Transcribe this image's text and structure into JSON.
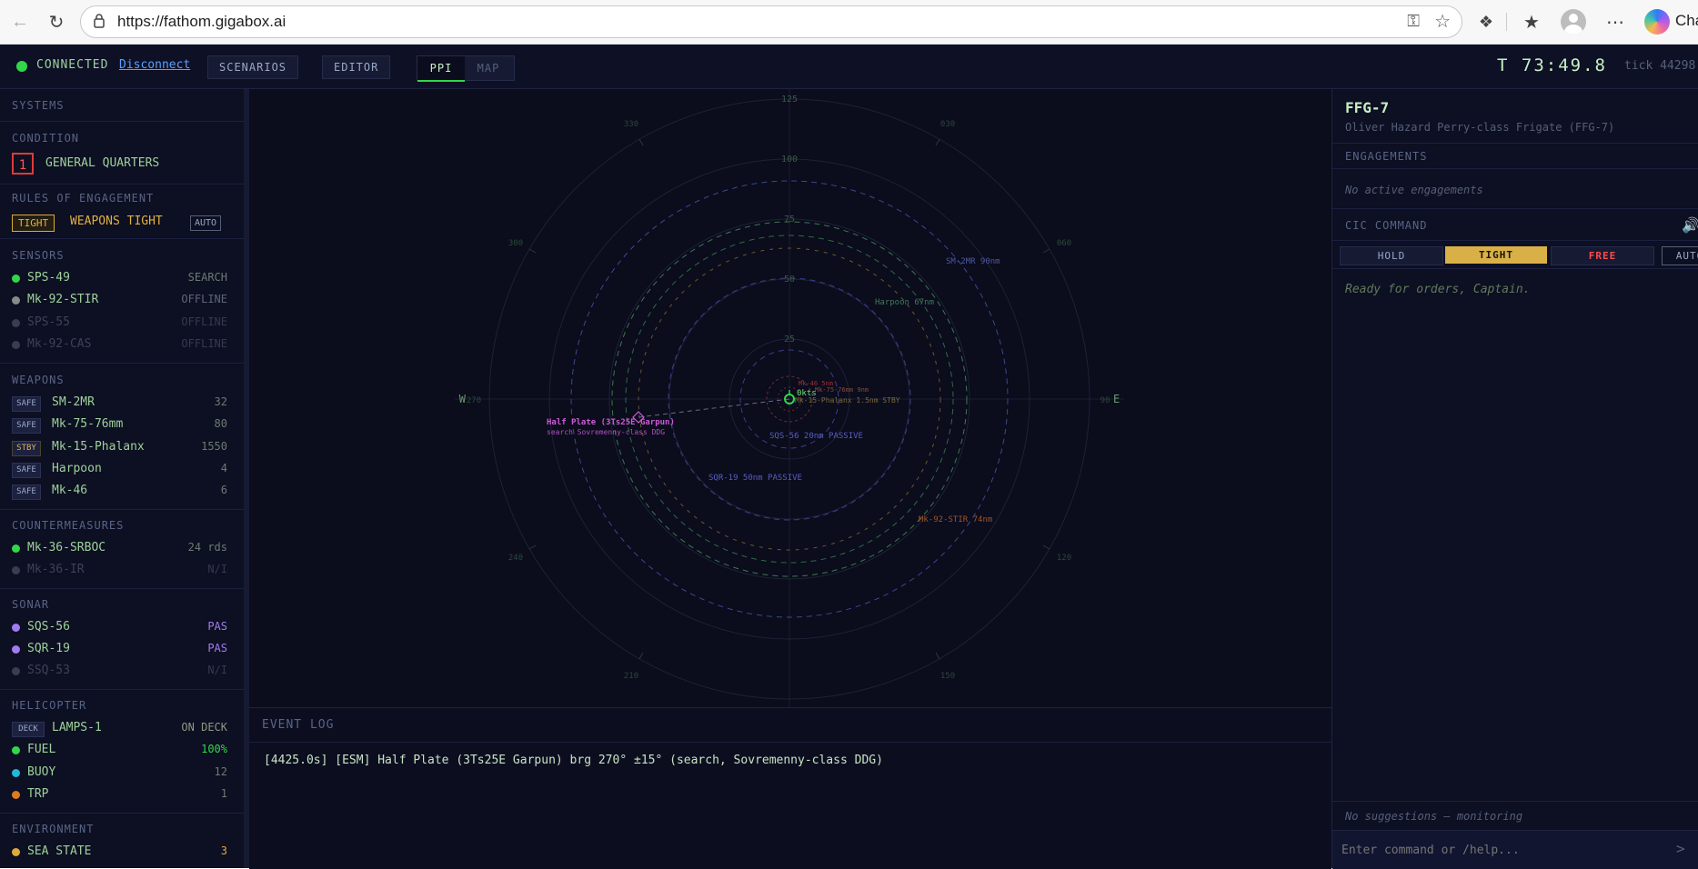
{
  "browser": {
    "url": "https://fathom.gigabox.ai",
    "copilot_label": "Cha"
  },
  "topbar": {
    "status": "CONNECTED",
    "disconnect": "Disconnect",
    "scenarios": "SCENARIOS",
    "editor": "EDITOR",
    "view_tabs": [
      {
        "label": "PPI",
        "active": true
      },
      {
        "label": "MAP",
        "active": false
      }
    ],
    "clock": "T 73:49.8",
    "tick": "tick 44298"
  },
  "systems": {
    "title": "SYSTEMS",
    "condition": {
      "title": "CONDITION",
      "number": "1",
      "label": "GENERAL QUARTERS"
    },
    "roe": {
      "title": "RULES OF ENGAGEMENT",
      "badge": "TIGHT",
      "label": "WEAPONS TIGHT",
      "auto": "AUTO"
    },
    "sensors": {
      "title": "SENSORS",
      "items": [
        {
          "name": "SPS-49",
          "value": "SEARCH",
          "color": "#32d64a"
        },
        {
          "name": "Mk-92-STIR",
          "value": "OFFLINE",
          "color": "#8a8a8a"
        },
        {
          "name": "SPS-55",
          "value": "OFFLINE",
          "color": "#3a3d52"
        },
        {
          "name": "Mk-92-CAS",
          "value": "OFFLINE",
          "color": "#3a3d52"
        }
      ]
    },
    "weapons": {
      "title": "WEAPONS",
      "items": [
        {
          "badge": "SAFE",
          "name": "SM-2MR",
          "value": "32"
        },
        {
          "badge": "SAFE",
          "name": "Mk-75-76mm",
          "value": "80"
        },
        {
          "badge": "STBY",
          "name": "Mk-15-Phalanx",
          "value": "1550"
        },
        {
          "badge": "SAFE",
          "name": "Harpoon",
          "value": "4"
        },
        {
          "badge": "SAFE",
          "name": "Mk-46",
          "value": "6"
        }
      ]
    },
    "countermeasures": {
      "title": "COUNTERMEASURES",
      "items": [
        {
          "name": "Mk-36-SRBOC",
          "value": "24 rds",
          "color": "#32d64a"
        },
        {
          "name": "Mk-36-IR",
          "value": "N/I",
          "color": "#3a3d52"
        }
      ]
    },
    "sonar": {
      "title": "SONAR",
      "items": [
        {
          "name": "SQS-56",
          "value": "PAS",
          "color": "#a07cf0"
        },
        {
          "name": "SQR-19",
          "value": "PAS",
          "color": "#a07cf0"
        },
        {
          "name": "SSQ-53",
          "value": "N/I",
          "color": "#3a3d52"
        }
      ]
    },
    "helicopter": {
      "title": "HELICOPTER",
      "items": [
        {
          "badge": "DECK",
          "name": "LAMPS-1",
          "value": "ON DECK"
        },
        {
          "name": "FUEL",
          "value": "100%",
          "color": "#32d64a"
        },
        {
          "name": "BUOY",
          "value": "12",
          "color": "#22b8d8"
        },
        {
          "name": "TRP",
          "value": "1",
          "color": "#e07a1e"
        }
      ]
    },
    "environment": {
      "title": "ENVIRONMENT",
      "items": [
        {
          "name": "SEA STATE",
          "value": "3",
          "color": "#e0a93a"
        }
      ]
    }
  },
  "ppi": {
    "range_labels": [
      "125",
      "100",
      "75",
      "50",
      "25"
    ],
    "compass_labels": {
      "w": "W",
      "e": "E"
    },
    "bearing_labels": [
      "330",
      "030",
      "300",
      "060",
      "240",
      "120",
      "210",
      "150"
    ],
    "west_tick": "270",
    "east_tick": "90",
    "own_ship_label": "0kts",
    "circle_labels": [
      {
        "text": "SM-2MR 90nm",
        "color": "#4a5aa8"
      },
      {
        "text": "Harpoon 67nm",
        "color": "#3f7a5a"
      },
      {
        "text": "SQS-56 20nm PASSIVE",
        "color": "#5a5ec0"
      },
      {
        "text": "SQR-19 50nm PASSIVE",
        "color": "#5a5ec0"
      },
      {
        "text": "Mk-92-STIR 74nm",
        "color": "#a0552a"
      },
      {
        "text": "Mk-15-Phalanx 1.5nm STBY",
        "color": "#7a6a3a"
      },
      {
        "text": "Mk-75-76mm 9nm",
        "color": "#8a4a3a"
      },
      {
        "text": "Mk-46 5nm",
        "color": "#a03030"
      }
    ],
    "contact": {
      "name": "Half Plate (3Ts25E Garpun)",
      "detail": "search Sovremenny-class DDG",
      "color": "#d05ad8"
    }
  },
  "event_log": {
    "title": "EVENT LOG",
    "lines": [
      "[4425.0s] [ESM] Half Plate (3Ts25E Garpun) brg 270° ±15° (search, Sovremenny-class DDG)"
    ]
  },
  "ship": {
    "name": "FFG-7",
    "subtitle": "Oliver Hazard Perry-class Frigate (FFG-7)"
  },
  "engagements": {
    "title": "ENGAGEMENTS",
    "empty": "No active engagements"
  },
  "cic": {
    "title": "CIC COMMAND",
    "roe_buttons": [
      {
        "label": "HOLD",
        "active": false
      },
      {
        "label": "TIGHT",
        "active": true
      },
      {
        "label": "FREE",
        "active": false
      },
      {
        "label": "AUTO",
        "active": false
      }
    ],
    "ready": "Ready for orders, Captain.",
    "suggestions": "No suggestions — monitoring",
    "input_placeholder": "Enter command or /help..."
  }
}
